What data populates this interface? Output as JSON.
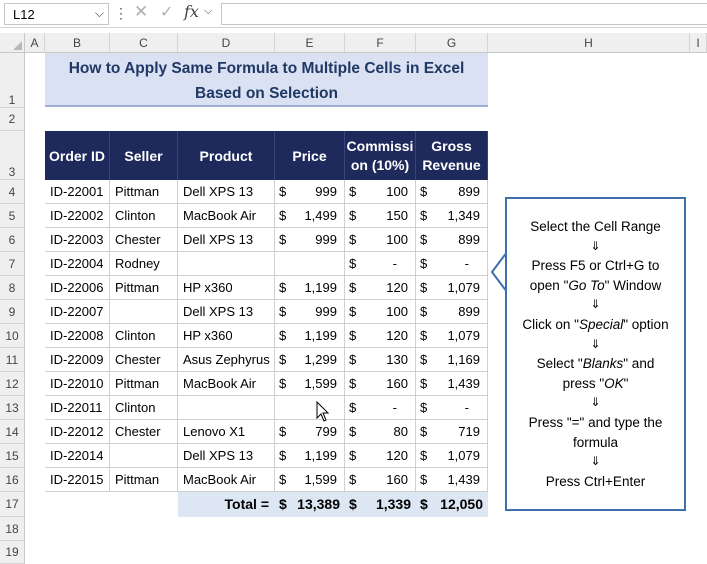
{
  "formula_bar": {
    "name_box": "L12",
    "cancel_icon": "✕",
    "enter_icon": "✓",
    "fx_label": "fx",
    "formula": ""
  },
  "columns": [
    "A",
    "B",
    "C",
    "D",
    "E",
    "F",
    "G",
    "H",
    "I"
  ],
  "rows": [
    "1",
    "2",
    "3",
    "4",
    "5",
    "6",
    "7",
    "8",
    "9",
    "10",
    "11",
    "12",
    "13",
    "14",
    "15",
    "16",
    "17",
    "18",
    "19"
  ],
  "title": "How to Apply Same Formula to Multiple Cells in Excel Based on Selection",
  "table": {
    "headers": [
      "Order ID",
      "Seller",
      "Product",
      "Price",
      "Commission (10%)",
      "Gross Revenue"
    ],
    "header_display": {
      "commission_line1": "Commissi",
      "commission_line2": "on (10%)",
      "gross_line1": "Gross",
      "gross_line2": "Revenue"
    },
    "currency": "$",
    "rows": [
      {
        "id": "ID-22001",
        "seller": "Pittman",
        "product": "Dell XPS 13",
        "price": "999",
        "commission": "100",
        "gross": "899"
      },
      {
        "id": "ID-22002",
        "seller": "Clinton",
        "product": "MacBook Air",
        "price": "1,499",
        "commission": "150",
        "gross": "1,349"
      },
      {
        "id": "ID-22003",
        "seller": "Chester",
        "product": "Dell XPS 13",
        "price": "999",
        "commission": "100",
        "gross": "899"
      },
      {
        "id": "ID-22004",
        "seller": "Rodney",
        "product": "",
        "price": "",
        "commission": "-",
        "gross": "-"
      },
      {
        "id": "ID-22006",
        "seller": "Pittman",
        "product": "HP  x360",
        "price": "1,199",
        "commission": "120",
        "gross": "1,079"
      },
      {
        "id": "ID-22007",
        "seller": "",
        "product": "Dell XPS 13",
        "price": "999",
        "commission": "100",
        "gross": "899"
      },
      {
        "id": "ID-22008",
        "seller": "Clinton",
        "product": "HP  x360",
        "price": "1,199",
        "commission": "120",
        "gross": "1,079"
      },
      {
        "id": "ID-22009",
        "seller": "Chester",
        "product": "Asus Zephyrus",
        "price": "1,299",
        "commission": "130",
        "gross": "1,169"
      },
      {
        "id": "ID-22010",
        "seller": "Pittman",
        "product": "MacBook Air",
        "price": "1,599",
        "commission": "160",
        "gross": "1,439"
      },
      {
        "id": "ID-22011",
        "seller": "Clinton",
        "product": "",
        "price": "",
        "commission": "-",
        "gross": "-"
      },
      {
        "id": "ID-22012",
        "seller": "Chester",
        "product": "Lenovo  X1",
        "price": "799",
        "commission": "80",
        "gross": "719"
      },
      {
        "id": "ID-22014",
        "seller": "",
        "product": "Dell XPS 13",
        "price": "1,199",
        "commission": "120",
        "gross": "1,079"
      },
      {
        "id": "ID-22015",
        "seller": "Pittman",
        "product": "MacBook Air",
        "price": "1,599",
        "commission": "160",
        "gross": "1,439"
      }
    ],
    "total": {
      "label": "Total =",
      "price": "13,389",
      "commission": "1,339",
      "gross": "12,050"
    }
  },
  "note": {
    "arrow": "⇓",
    "steps": [
      {
        "lines": [
          "Select the Cell Range"
        ]
      },
      {
        "lines": [
          "Press F5 or Ctrl+G to",
          "open \"|Go To|\" Window"
        ]
      },
      {
        "lines": [
          "Click on \"|Special|\" option"
        ]
      },
      {
        "lines": [
          "Select \"|Blanks|\" and",
          "press \"|OK|\""
        ]
      },
      {
        "lines": [
          "Press \"=\" and type the",
          "formula"
        ]
      },
      {
        "lines": [
          "Press Ctrl+Enter"
        ]
      }
    ]
  },
  "colors": {
    "header_bg": "#1f2a5c",
    "title_bg": "#d9e1f2",
    "title_text": "#1f3864",
    "note_border": "#3f6fad",
    "total_bg": "#dde6f3"
  },
  "icons": {
    "cancel": "close-icon",
    "enter": "check-icon",
    "function": "fx-icon",
    "cursor": "mouse-pointer-icon"
  }
}
